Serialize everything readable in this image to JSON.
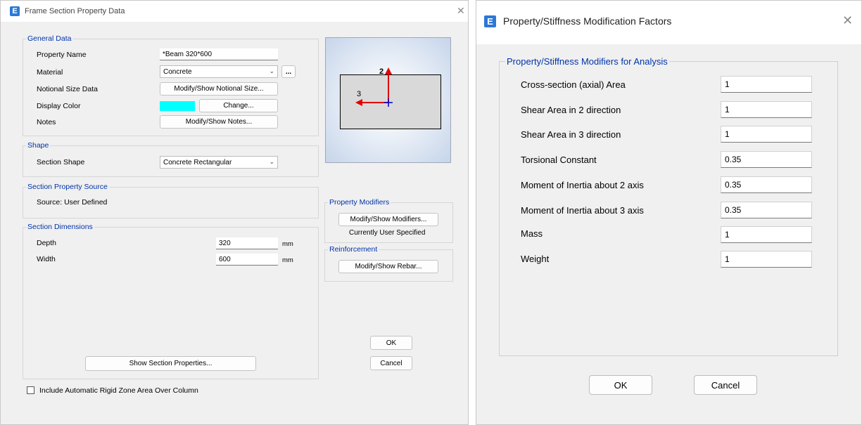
{
  "left_dialog": {
    "title": "Frame Section Property Data",
    "icon": "E",
    "general_data": {
      "legend": "General Data",
      "property_name_label": "Property Name",
      "property_name_value": "*Beam 320*600",
      "material_label": "Material",
      "material_value": "Concrete",
      "material_button": "...",
      "notional_label": "Notional Size Data",
      "notional_button": "Modify/Show Notional Size...",
      "display_color_label": "Display Color",
      "display_color": "#00ffff",
      "change_button": "Change...",
      "notes_label": "Notes",
      "notes_button": "Modify/Show Notes..."
    },
    "shape": {
      "legend": "Shape",
      "section_shape_label": "Section Shape",
      "section_shape_value": "Concrete Rectangular"
    },
    "source": {
      "legend": "Section Property Source",
      "text": "Source:  User Defined"
    },
    "dimensions": {
      "legend": "Section Dimensions",
      "depth_label": "Depth",
      "depth_value": "320",
      "depth_unit": "mm",
      "width_label": "Width",
      "width_value": "600",
      "width_unit": "mm",
      "show_properties_button": "Show Section Properties..."
    },
    "preview": {
      "axis2_label": "2",
      "axis3_label": "3",
      "rect_fill": "#d9d9d9",
      "axis_colors": {
        "arrow": "#e00000",
        "origin": "#0000cc"
      }
    },
    "property_modifiers": {
      "legend": "Property Modifiers",
      "button": "Modify/Show Modifiers...",
      "status": "Currently User Specified"
    },
    "reinforcement": {
      "legend": "Reinforcement",
      "button": "Modify/Show Rebar..."
    },
    "ok_button": "OK",
    "cancel_button": "Cancel",
    "rigid_zone_checkbox_label": "Include Automatic Rigid Zone Area Over Column",
    "rigid_zone_checked": false
  },
  "right_dialog": {
    "title": "Property/Stiffness Modification Factors",
    "icon": "E",
    "group_legend": "Property/Stiffness Modifiers for Analysis",
    "rows": [
      {
        "label": "Cross-section (axial) Area",
        "value": "1"
      },
      {
        "label": "Shear Area in 2 direction",
        "value": "1"
      },
      {
        "label": "Shear Area in 3 direction",
        "value": "1"
      },
      {
        "label": "Torsional Constant",
        "value": "0.35"
      },
      {
        "label": "Moment of Inertia about 2 axis",
        "value": "0.35"
      },
      {
        "label": "Moment of Inertia about 3 axis",
        "value": "0.35"
      },
      {
        "label": "Mass",
        "value": "1"
      },
      {
        "label": "Weight",
        "value": "1"
      }
    ],
    "ok_button": "OK",
    "cancel_button": "Cancel"
  },
  "colors": {
    "legend_blue": "#0033aa",
    "brand_icon": "#2b78d6",
    "dialog_bg": "#f0f0f0"
  }
}
